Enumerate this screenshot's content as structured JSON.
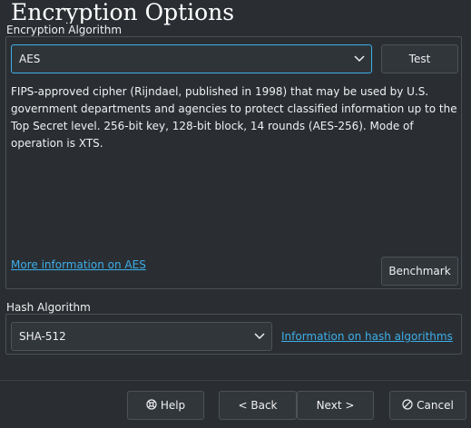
{
  "window": {
    "title": "Encryption Options"
  },
  "encryption": {
    "group_label": "Encryption Algorithm",
    "algorithm_value": "AES",
    "test_label": "Test",
    "description": "FIPS-approved cipher (Rijndael, published in 1998) that may be used by U.S. government departments and agencies to protect classified information up to the Top Secret level. 256-bit key, 128-bit block, 14 rounds (AES-256). Mode of operation is XTS.",
    "more_info_link": "More information on AES",
    "benchmark_label": "Benchmark"
  },
  "hash": {
    "group_label": "Hash Algorithm",
    "value": "SHA-512",
    "info_link": "Information on hash algorithms"
  },
  "footer": {
    "help_label": "Help",
    "back_label": "< Back",
    "next_label": "Next >",
    "cancel_label": "Cancel"
  },
  "colors": {
    "background": "#2a2e32",
    "control_bg": "#31363b",
    "border": "#4d5257",
    "accent": "#3daee9",
    "text": "#eff0f1"
  },
  "icons": {
    "help": "help-icon",
    "cancel": "cancel-icon",
    "dropdown": "chevron-down-icon"
  }
}
